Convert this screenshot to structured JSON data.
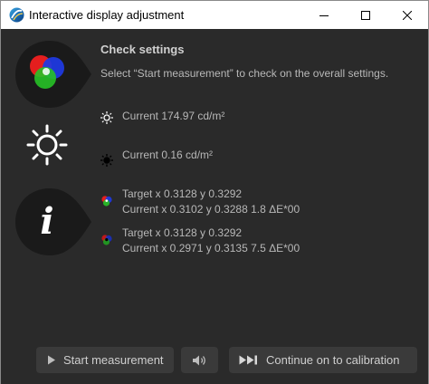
{
  "window": {
    "title": "Interactive display adjustment"
  },
  "icons": {
    "app": "display-calibration-app-icon",
    "rgb_big": "rgb-circles-icon",
    "sun_big": "brightness-sun-icon",
    "info": "info-i-icon",
    "sun_small": "white-level-sun-icon",
    "sun_dark": "black-level-sun-icon",
    "rgb_small": "rgb-small-icon",
    "rgb_small_dark": "rgb-small-dark-icon",
    "play": "play-icon",
    "speaker": "speaker-icon",
    "skip": "skip-forward-icon"
  },
  "main": {
    "heading": "Check settings",
    "description": "Select “Start measurement” to check on the overall settings.",
    "white_level": "Current 174.97 cd/m²",
    "black_level": "Current 0.16 cd/m²",
    "white_point": {
      "target": "Target x 0.3128 y 0.3292",
      "current": "Current x 0.3102 y 0.3288 1.8 ΔE*00"
    },
    "black_point": {
      "target": "Target x 0.3128 y 0.3292",
      "current": "Current x 0.2971 y 0.3135 7.5 ΔE*00"
    }
  },
  "buttons": {
    "start": "Start measurement",
    "continue": "Continue on to calibration"
  },
  "colors": {
    "background": "#2a2a2a",
    "button": "#3a3a3a",
    "blob": "#1a1a1a",
    "text": "#b8b8b8"
  }
}
